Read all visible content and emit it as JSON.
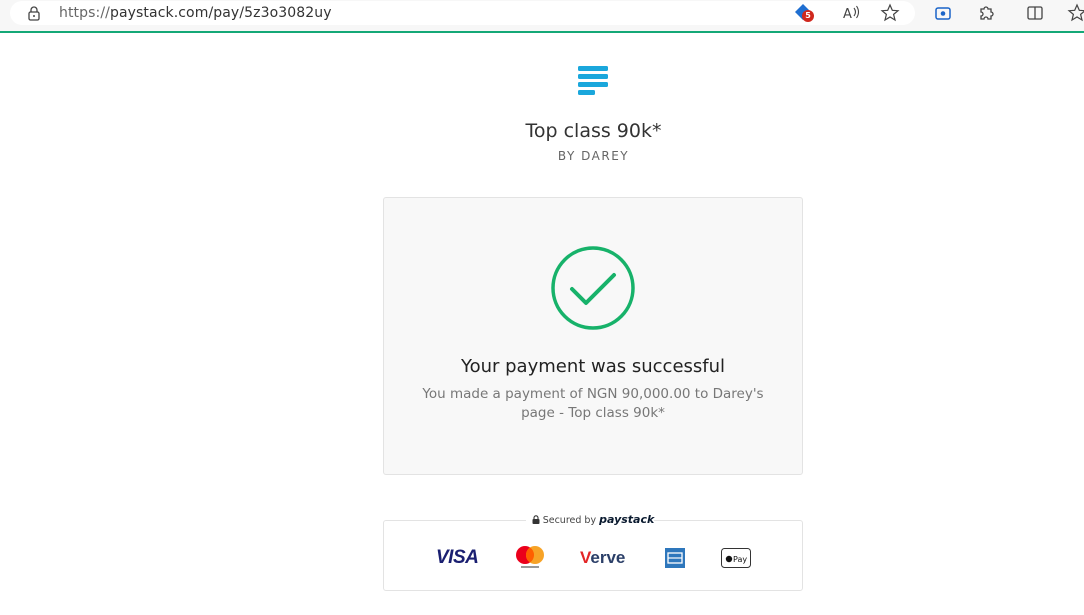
{
  "browser": {
    "url_scheme": "https://",
    "url_rest": "paystack.com/pay/5z3o3082uy",
    "extension_badge": "5"
  },
  "page": {
    "title": "Top class 90k*",
    "byline": "BY DAREY"
  },
  "status": {
    "heading": "Your payment was successful",
    "message": "You made a payment of NGN 90,000.00 to Darey's page - Top class 90k*",
    "accent_color": "#17b26a"
  },
  "footer": {
    "secured_label": "Secured by",
    "secured_brand": "paystack",
    "payment_methods": [
      "VISA",
      "Mastercard",
      "Verve",
      "American Express",
      "Apple Pay"
    ],
    "visa_label": "VISA",
    "verve_label_first": "V",
    "verve_label_rest": "erve",
    "applepay_label": "Pay"
  }
}
